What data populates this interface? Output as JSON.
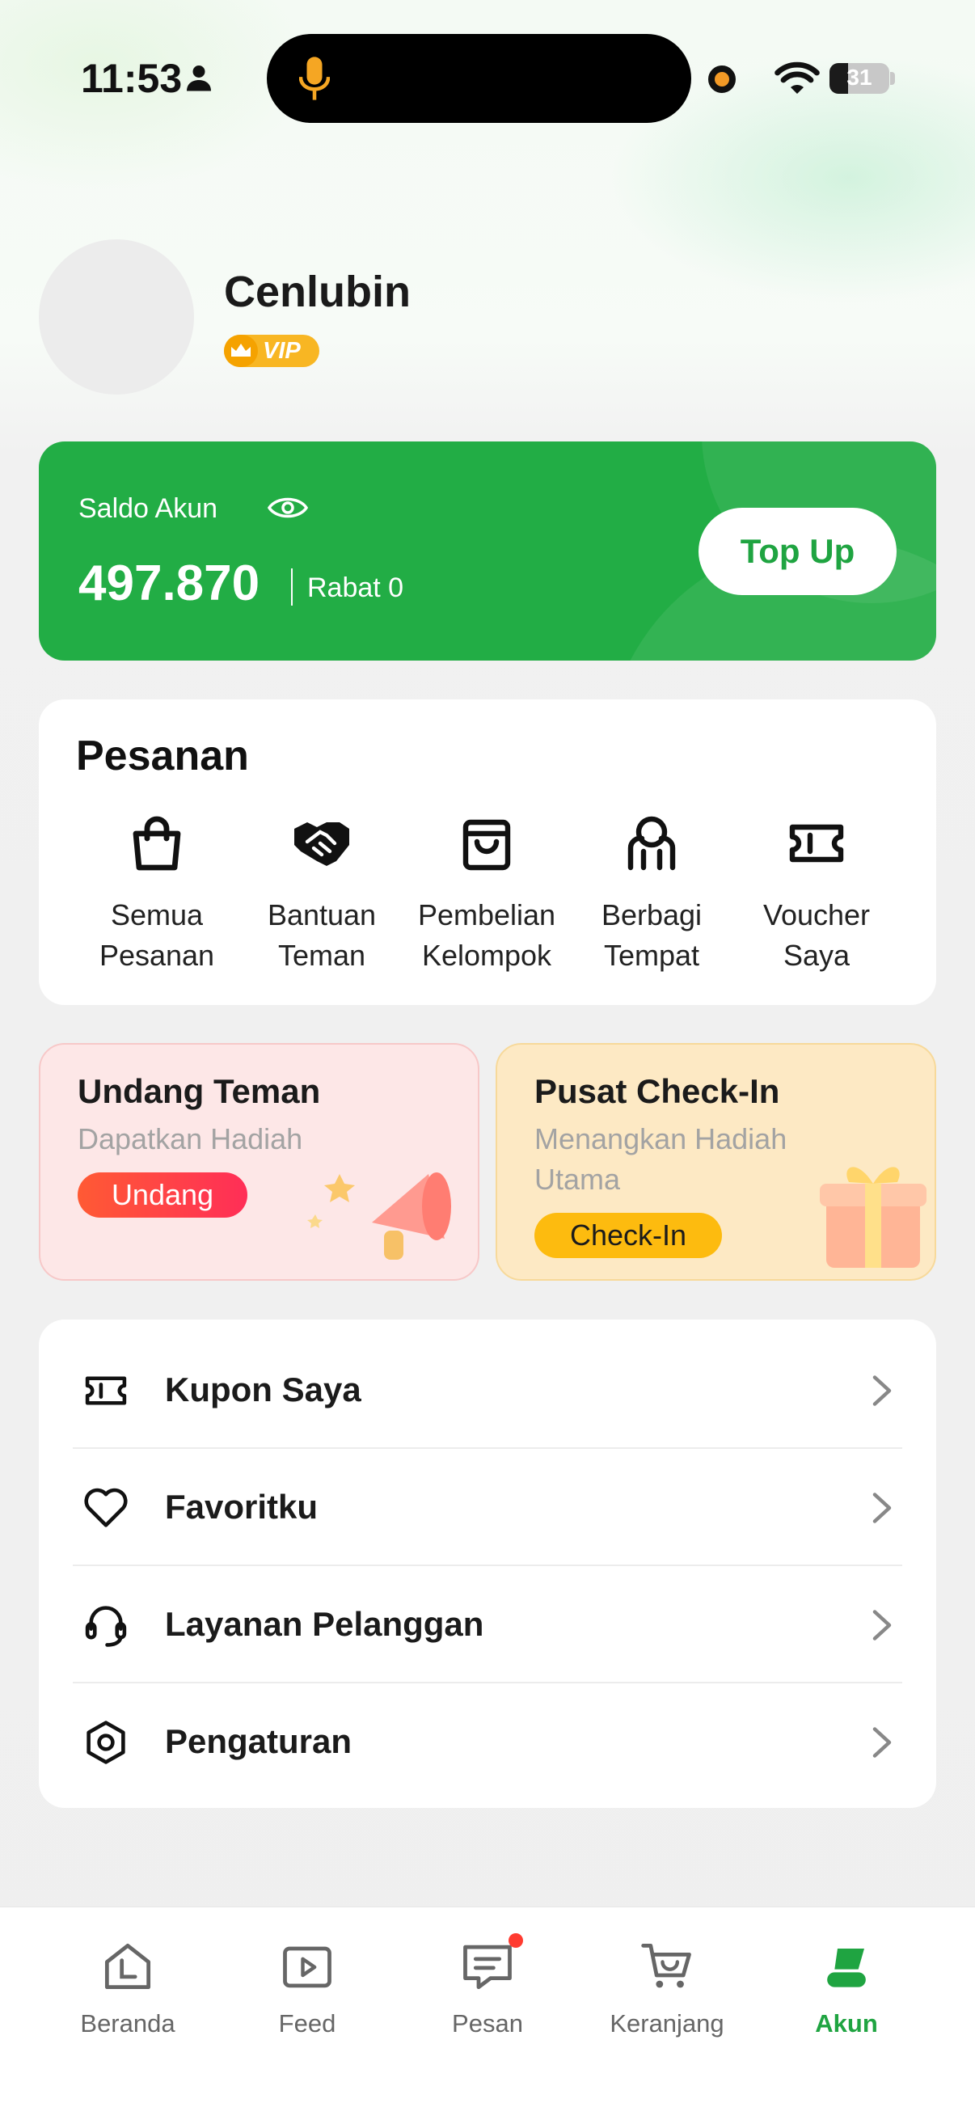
{
  "status_bar": {
    "time": "11:53",
    "battery": "31",
    "battery_level": 0.31
  },
  "profile": {
    "name": "Cenlubin",
    "badge": "VIP"
  },
  "balance": {
    "label": "Saldo Akun",
    "amount": "497.870",
    "rebate": "Rabat 0",
    "topup_label": "Top Up"
  },
  "orders": {
    "title": "Pesanan",
    "items": [
      {
        "label": "Semua Pesanan",
        "icon": "shopping-bag-icon"
      },
      {
        "label": "Bantuan Teman",
        "icon": "handshake-icon"
      },
      {
        "label": "Pembelian Kelompok",
        "icon": "group-buy-bag-icon"
      },
      {
        "label": "Berbagi Tempat",
        "icon": "share-people-icon"
      },
      {
        "label": "Voucher Saya",
        "icon": "ticket-icon"
      }
    ]
  },
  "promos": {
    "invite": {
      "title": "Undang Teman",
      "subtitle": "Dapatkan Hadiah",
      "button": "Undang"
    },
    "checkin": {
      "title": "Pusat Check-In",
      "subtitle": "Menangkan Hadiah Utama",
      "button": "Check-In"
    }
  },
  "menu": {
    "items": [
      {
        "label": "Kupon Saya",
        "icon": "coupon-icon"
      },
      {
        "label": "Favoritku",
        "icon": "heart-icon"
      },
      {
        "label": "Layanan Pelanggan",
        "icon": "headset-icon"
      },
      {
        "label": "Pengaturan",
        "icon": "settings-icon"
      }
    ]
  },
  "nav": {
    "items": [
      {
        "label": "Beranda",
        "icon": "home-icon"
      },
      {
        "label": "Feed",
        "icon": "video-icon"
      },
      {
        "label": "Pesan",
        "icon": "message-icon"
      },
      {
        "label": "Keranjang",
        "icon": "cart-icon"
      },
      {
        "label": "Akun",
        "icon": "account-icon"
      }
    ],
    "active": "Akun"
  },
  "colors": {
    "brand_green": "#22ad45",
    "notification_red": "#ff3b30"
  }
}
